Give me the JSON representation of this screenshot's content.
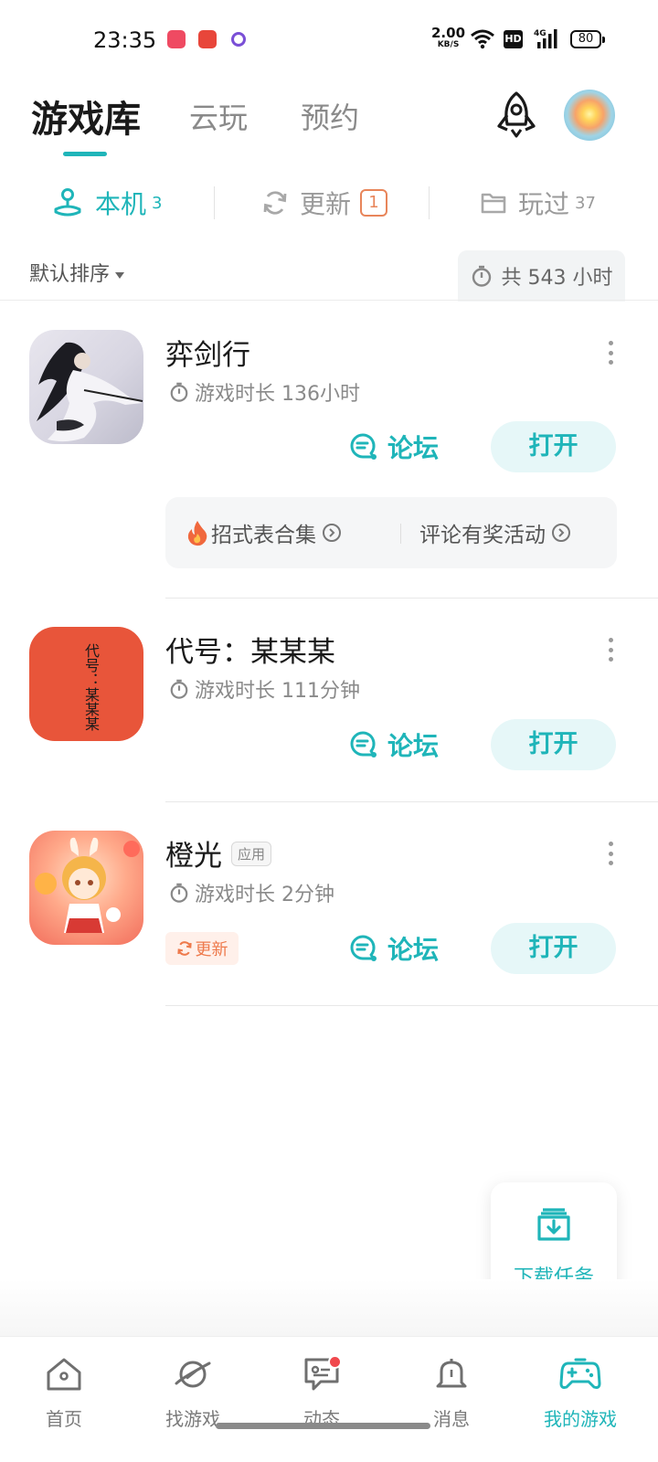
{
  "status_bar": {
    "time": "23:35",
    "net_speed": "2.00",
    "net_unit": "KB/S",
    "hd": "HD",
    "network": "4G",
    "battery": "80"
  },
  "header": {
    "tabs": [
      "游戏库",
      "云玩",
      "预约"
    ],
    "active_tab": "游戏库"
  },
  "subtabs": {
    "local": {
      "label": "本机",
      "count": "3"
    },
    "update": {
      "label": "更新",
      "count": "1"
    },
    "played": {
      "label": "玩过",
      "count": "37"
    }
  },
  "sort": {
    "label": "默认排序",
    "total": "共 543 小时"
  },
  "games": [
    {
      "name": "弈剑行",
      "tag": "",
      "time": "游戏时长 136小时",
      "forum": "论坛",
      "open": "打开"
    },
    {
      "name": "代号：某某某",
      "tag": "",
      "time": "游戏时长 111分钟",
      "forum": "论坛",
      "open": "打开",
      "icon_text": "代号：某某某"
    },
    {
      "name": "橙光",
      "tag": "应用",
      "time": "游戏时长 2分钟",
      "forum": "论坛",
      "open": "打开",
      "update_chip": "更新"
    }
  ],
  "promo": {
    "left": "招式表合集",
    "right": "评论有奖活动"
  },
  "download_task": "下载任务",
  "bottom_nav": [
    {
      "label": "首页",
      "icon": "home-icon"
    },
    {
      "label": "找游戏",
      "icon": "planet-icon"
    },
    {
      "label": "动态",
      "icon": "chat-icon"
    },
    {
      "label": "消息",
      "icon": "bell-icon"
    },
    {
      "label": "我的游戏",
      "icon": "gamepad-icon",
      "active": true
    }
  ],
  "colors": {
    "accent": "#1fb5b9",
    "accent_bg": "#e6f7f8",
    "update_orange": "#e8855a",
    "badge_red": "#f0484d"
  }
}
